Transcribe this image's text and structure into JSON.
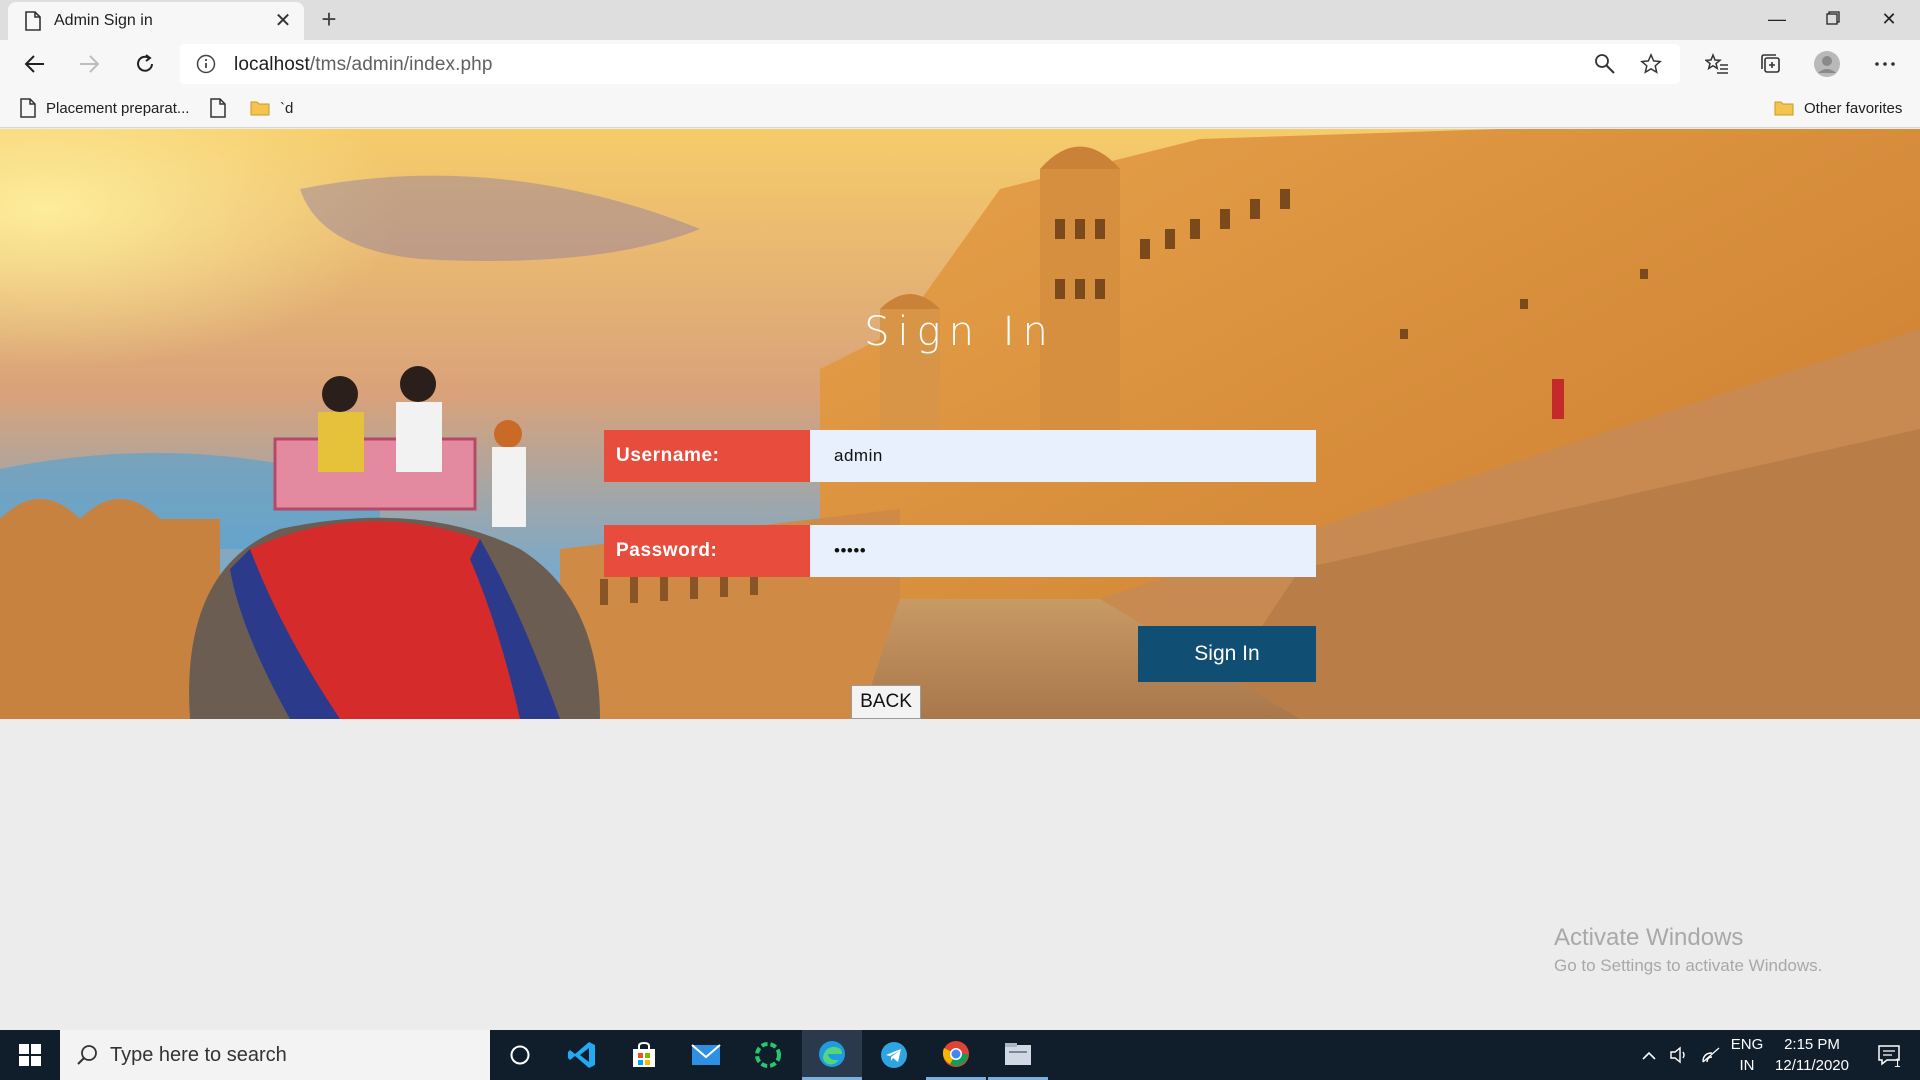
{
  "browser": {
    "tab_title": "Admin Sign in",
    "url_host": "localhost",
    "url_path": "/tms/admin/index.php",
    "bookmarks": [
      {
        "label": "Placement preparat...",
        "icon": "page-icon"
      },
      {
        "label": "",
        "icon": "page-icon"
      },
      {
        "label": "`d",
        "icon": "folder-icon"
      }
    ],
    "other_favorites": "Other favorites"
  },
  "page": {
    "heading": "Sign In",
    "username_label": "Username:",
    "username_value": "admin",
    "password_label": "Password:",
    "password_value": "•••••",
    "signin_button": "Sign In",
    "back_button": "BACK"
  },
  "watermark": {
    "line1": "Activate Windows",
    "line2": "Go to Settings to activate Windows."
  },
  "taskbar": {
    "search_placeholder": "Type here to search",
    "lang_line1": "ENG",
    "lang_line2": "IN",
    "time": "2:15 PM",
    "date": "12/11/2020",
    "notification_count": "1",
    "apps": [
      "cortana-icon",
      "vscode-icon",
      "store-icon",
      "mail-icon",
      "progress-app-icon",
      "edge-icon",
      "telegram-icon",
      "chrome-icon",
      "explorer-icon"
    ]
  },
  "colors": {
    "label_bg": "#e74c3c",
    "input_bg": "#e8f0fe",
    "signin_bg": "#114e74",
    "taskbar_bg": "#101d2b"
  }
}
